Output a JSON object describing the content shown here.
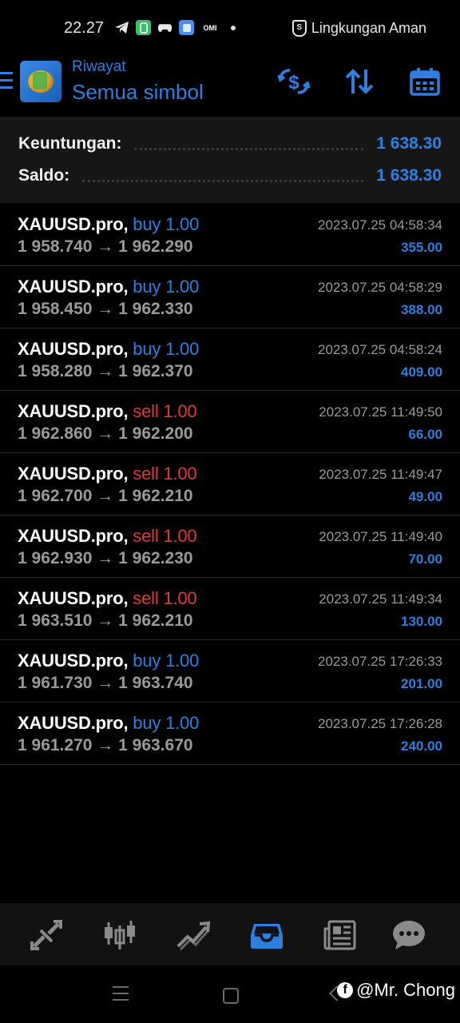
{
  "statusbar": {
    "time": "22.27",
    "icons": [
      "telegram-icon",
      "whatsapp-icon",
      "gamepad-icon",
      "notes-icon",
      "omi-icon"
    ],
    "network_label": "Lingkungan Aman"
  },
  "appbar": {
    "subtitle": "Riwayat",
    "title": "Semua simbol",
    "accent": "#2f7fe0"
  },
  "summary": {
    "profit_label": "Keuntungan:",
    "profit_value": "1 638.30",
    "balance_label": "Saldo:",
    "balance_value": "1 638.30"
  },
  "deals": [
    {
      "symbol": "XAUUSD.pro,",
      "type": "buy",
      "volume": "1.00",
      "open": "1 958.740",
      "close": "1 962.290",
      "time": "2023.07.25 04:58:34",
      "profit": "355.00"
    },
    {
      "symbol": "XAUUSD.pro,",
      "type": "buy",
      "volume": "1.00",
      "open": "1 958.450",
      "close": "1 962.330",
      "time": "2023.07.25 04:58:29",
      "profit": "388.00"
    },
    {
      "symbol": "XAUUSD.pro,",
      "type": "buy",
      "volume": "1.00",
      "open": "1 958.280",
      "close": "1 962.370",
      "time": "2023.07.25 04:58:24",
      "profit": "409.00"
    },
    {
      "symbol": "XAUUSD.pro,",
      "type": "sell",
      "volume": "1.00",
      "open": "1 962.860",
      "close": "1 962.200",
      "time": "2023.07.25 11:49:50",
      "profit": "66.00"
    },
    {
      "symbol": "XAUUSD.pro,",
      "type": "sell",
      "volume": "1.00",
      "open": "1 962.700",
      "close": "1 962.210",
      "time": "2023.07.25 11:49:47",
      "profit": "49.00"
    },
    {
      "symbol": "XAUUSD.pro,",
      "type": "sell",
      "volume": "1.00",
      "open": "1 962.930",
      "close": "1 962.230",
      "time": "2023.07.25 11:49:40",
      "profit": "70.00"
    },
    {
      "symbol": "XAUUSD.pro,",
      "type": "sell",
      "volume": "1.00",
      "open": "1 963.510",
      "close": "1 962.210",
      "time": "2023.07.25 11:49:34",
      "profit": "130.00"
    },
    {
      "symbol": "XAUUSD.pro,",
      "type": "buy",
      "volume": "1.00",
      "open": "1 961.730",
      "close": "1 963.740",
      "time": "2023.07.25 17:26:33",
      "profit": "201.00"
    },
    {
      "symbol": "XAUUSD.pro,",
      "type": "buy",
      "volume": "1.00",
      "open": "1 961.270",
      "close": "1 963.670",
      "time": "2023.07.25 17:26:28",
      "profit": "240.00"
    }
  ],
  "bottom_nav": [
    {
      "name": "quotes-icon",
      "active": false
    },
    {
      "name": "chart-icon",
      "active": false
    },
    {
      "name": "trade-icon",
      "active": false
    },
    {
      "name": "history-icon",
      "active": true
    },
    {
      "name": "news-icon",
      "active": false
    },
    {
      "name": "messages-icon",
      "active": false
    }
  ],
  "watermark": {
    "handle": "@Mr. Chong"
  }
}
